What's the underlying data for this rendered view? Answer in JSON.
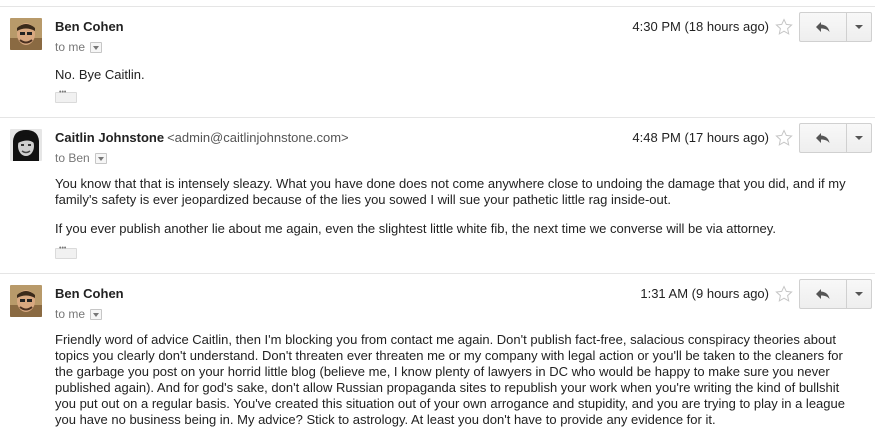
{
  "messages": [
    {
      "sender": "Ben Cohen",
      "email": "",
      "to_label": "to me",
      "time": "4:30 PM (18 hours ago)",
      "paragraphs": [
        "No. Bye Caitlin."
      ]
    },
    {
      "sender": "Caitlin Johnstone",
      "email": "<admin@caitlinjohnstone.com>",
      "to_label": "to Ben",
      "time": "4:48 PM (17 hours ago)",
      "paragraphs": [
        "You know that that is intensely sleazy. What you have done does not come anywhere close to undoing the damage that you did, and if my family's safety is ever jeopardized because of the lies you sowed I will sue your pathetic little rag inside-out.",
        "If you ever publish another lie about me again, even the slightest little white fib, the next time we converse will be via attorney."
      ]
    },
    {
      "sender": "Ben Cohen",
      "email": "",
      "to_label": "to me",
      "time": "1:31 AM (9 hours ago)",
      "paragraphs": [
        "Friendly word of advice Caitlin, then I'm blocking you from contact me again. Don't publish fact-free, salacious conspiracy theories about topics you clearly don't understand. Don't threaten ever threaten me or my company with legal action or you'll be taken to the cleaners for the garbage you post on your horrid little blog (believe me, I know plenty of lawyers in DC who would be happy to make sure you never published again). And for god's sake, don't allow Russian propaganda sites to republish your work when you're writing the kind of bullshit you put out on a regular basis. You've created this situation out of your own arrogance and stupidity, and you are trying to play in a league you have no business being in. My advice? Stick to astrology. At least you don't have to provide any evidence for it."
      ]
    }
  ],
  "icons": {
    "star": "star-outline-icon",
    "reply": "reply-arrow-icon",
    "more": "chevron-down-icon",
    "show_trimmed": "ellipsis-icon"
  }
}
